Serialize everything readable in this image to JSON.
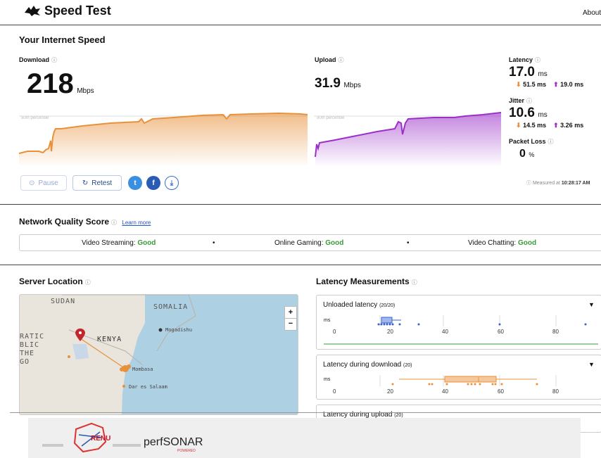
{
  "header": {
    "title": "Speed Test",
    "about": "About"
  },
  "speed": {
    "section_title": "Your Internet Speed",
    "download": {
      "label": "Download",
      "value": "218",
      "unit": "Mbps",
      "percentile": "90th percentile"
    },
    "upload": {
      "label": "Upload",
      "value": "31.9",
      "unit": "Mbps",
      "percentile": "90th percentile"
    },
    "latency": {
      "label": "Latency",
      "value": "17.0",
      "unit": "ms",
      "down": "51.5 ms",
      "up": "19.0 ms"
    },
    "jitter": {
      "label": "Jitter",
      "value": "10.6",
      "unit": "ms",
      "down": "14.5 ms",
      "up": "3.26 ms"
    },
    "packet_loss": {
      "label": "Packet Loss",
      "value": "0",
      "unit": "%"
    },
    "measured_prefix": "Measured at ",
    "measured_time": "10:28:17 AM"
  },
  "actions": {
    "pause": "Pause",
    "retest": "Retest"
  },
  "network_quality": {
    "title": "Network Quality Score",
    "learn_more": "Learn more",
    "items": [
      {
        "label": "Video Streaming: ",
        "rating": "Good"
      },
      {
        "label": "Online Gaming: ",
        "rating": "Good"
      },
      {
        "label": "Video Chatting: ",
        "rating": "Good"
      }
    ],
    "separator": "•"
  },
  "server": {
    "title": "Server Location",
    "map_labels": [
      "SUDAN",
      "SOMALIA",
      "KENYA",
      "Mogadishu",
      "Mombasa",
      "Dar es Salaam",
      "RATIC",
      "BLIC",
      "THE",
      "GO"
    ]
  },
  "latency_measure": {
    "title": "Latency Measurements",
    "cards": [
      {
        "title": "Unloaded latency",
        "count": "(20/20)",
        "unit": "ms",
        "ticks": [
          "0",
          "20",
          "40",
          "60",
          "80"
        ]
      },
      {
        "title": "Latency during download",
        "count": "(20)",
        "unit": "ms",
        "ticks": [
          "0",
          "20",
          "40",
          "60",
          "80"
        ]
      },
      {
        "title": "Latency during upload",
        "count": "(20)"
      }
    ]
  },
  "colors": {
    "download": "#e8913b",
    "upload": "#9b30c8",
    "good": "#3a9a3a",
    "link": "#2255cc",
    "twitter": "#3b8fe0",
    "facebook": "#2a5bb5"
  },
  "icons": [
    "cloudflare-logo",
    "info-icon",
    "pause-icon",
    "retest-icon",
    "twitter-icon",
    "facebook-icon",
    "download-icon",
    "zoom-in-icon",
    "zoom-out-icon",
    "map-marker-icon",
    "chevron-down-icon"
  ],
  "footer": {
    "renu_logo": "RENU",
    "perfsonar_logo": "perfSONAR",
    "perfsonar_sub": "POWERED"
  }
}
